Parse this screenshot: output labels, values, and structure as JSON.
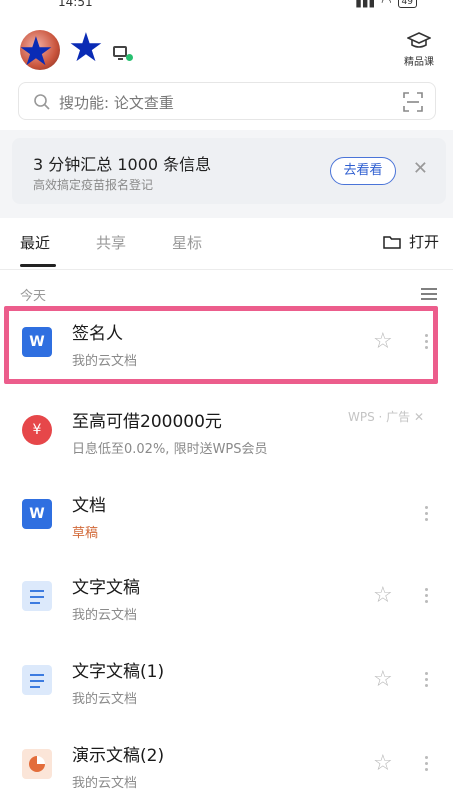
{
  "status_bar": {
    "time": "14:51",
    "battery": "49"
  },
  "header": {
    "course_label": "精品课"
  },
  "search": {
    "placeholder": "搜功能: 论文查重"
  },
  "banner": {
    "title": "3 分钟汇总 1000 条信息",
    "subtitle": "高效搞定疫苗报名登记",
    "button_label": "去看看",
    "close_symbol": "✕"
  },
  "tabs": [
    {
      "label": "最近",
      "active": true
    },
    {
      "label": "共享",
      "active": false
    },
    {
      "label": "星标",
      "active": false
    }
  ],
  "open_label": "打开",
  "section_label": "今天",
  "files": [
    {
      "title": "签名人",
      "subtitle": "我的云文档",
      "type": "word",
      "icon_letter": "W",
      "highlighted": true
    },
    {
      "title": "至高可借200000元",
      "subtitle": "日息低至0.02%, 限时送WPS会员",
      "type": "ad",
      "icon_letter": "¥",
      "ad_tag": "WPS · 广告 ✕"
    },
    {
      "title": "文档",
      "subtitle": "草稿",
      "type": "word",
      "icon_letter": "W"
    },
    {
      "title": "文字文稿",
      "subtitle": "我的云文档",
      "type": "text"
    },
    {
      "title": "文字文稿(1)",
      "subtitle": "我的云文档",
      "type": "text"
    },
    {
      "title": "演示文稿(2)",
      "subtitle": "我的云文档",
      "type": "ppt"
    }
  ],
  "colors": {
    "accent_blue": "#2f5fd0",
    "word_icon": "#2f6fe0",
    "highlight_border": "#ec5d8c",
    "draft_text": "#d26a3a",
    "star_overlay": "#0a2bb5"
  }
}
